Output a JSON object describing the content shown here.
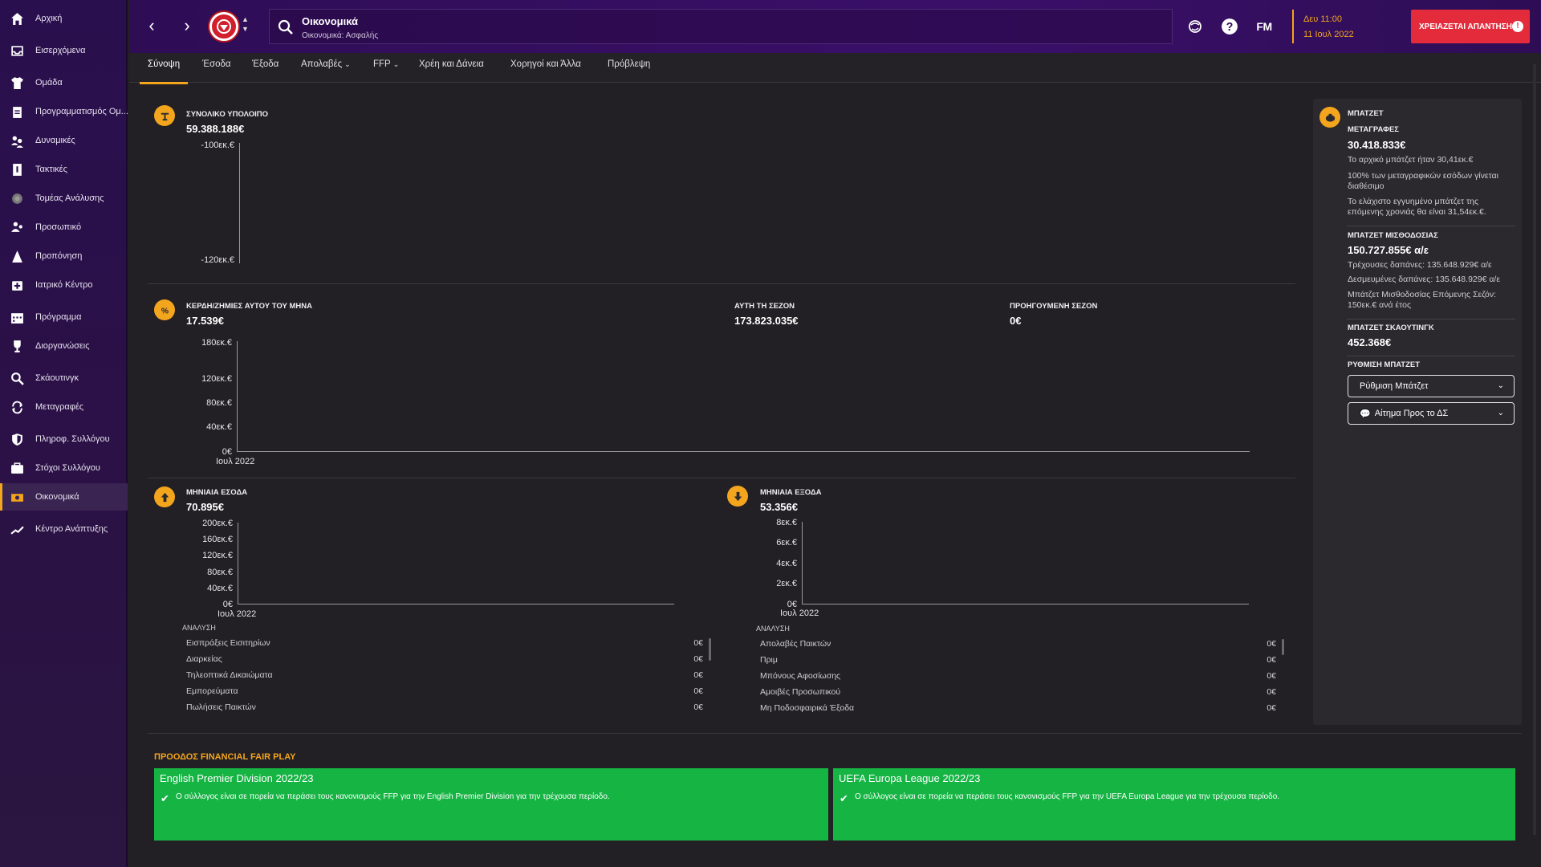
{
  "sidebar": {
    "items": [
      {
        "label": "Αρχική",
        "icon": "home-icon"
      },
      {
        "label": "Εισερχόμενα",
        "icon": "inbox-icon"
      },
      {
        "label": "Ομάδα",
        "icon": "shirt-icon"
      },
      {
        "label": "Προγραμματισμός Ομ...",
        "icon": "clipboard-icon"
      },
      {
        "label": "Δυναμικές",
        "icon": "people-dynamics-icon"
      },
      {
        "label": "Τακτικές",
        "icon": "tactics-board-icon"
      },
      {
        "label": "Τομέας Ανάλυσης",
        "icon": "analysis-icon"
      },
      {
        "label": "Προσωπικό",
        "icon": "staff-icon"
      },
      {
        "label": "Προπόνηση",
        "icon": "training-cone-icon"
      },
      {
        "label": "Ιατρικό Κέντρο",
        "icon": "medical-icon"
      },
      {
        "label": "Πρόγραμμα",
        "icon": "calendar-icon"
      },
      {
        "label": "Διοργανώσεις",
        "icon": "trophy-icon"
      },
      {
        "label": "Σκάουτινγκ",
        "icon": "scouting-icon"
      },
      {
        "label": "Μεταγραφές",
        "icon": "transfers-icon"
      },
      {
        "label": "Πληροφ. Συλλόγου",
        "icon": "club-shield-icon"
      },
      {
        "label": "Στόχοι Συλλόγου",
        "icon": "vision-icon"
      },
      {
        "label": "Οικονομικά",
        "icon": "finances-icon"
      },
      {
        "label": "Κέντρο Ανάπτυξης",
        "icon": "development-icon"
      }
    ],
    "active": "Οικονομικά"
  },
  "topbar": {
    "search_title": "Οικονομικά",
    "search_sub": "Οικονομικά: Ασφαλής",
    "fm_logo": "FM",
    "date_line1": "Δευ 11:00",
    "date_line2": "11 Ιουλ 2022",
    "reply_button": "ΧΡΕΙΑΖΕΤΑΙ ΑΠΑΝΤΗΣΗ",
    "reply_badge": "!"
  },
  "tabs": [
    {
      "label": "Σύνοψη",
      "dropdown": false
    },
    {
      "label": "Έσοδα",
      "dropdown": false
    },
    {
      "label": "Έξοδα",
      "dropdown": false
    },
    {
      "label": "Απολαβές",
      "dropdown": true
    },
    {
      "label": "FFP",
      "dropdown": true
    },
    {
      "label": "Χρέη και Δάνεια",
      "dropdown": false
    },
    {
      "label": "Χορηγοί και Άλλα",
      "dropdown": false
    },
    {
      "label": "Πρόβλεψη",
      "dropdown": false
    }
  ],
  "balance": {
    "label": "ΣΥΝΟΛΙΚΟ ΥΠΟΛΟΙΠΟ",
    "value": "59.388.188€",
    "y_ticks": [
      "-100εκ.€",
      "-120εκ.€"
    ]
  },
  "monthly_profit": {
    "label": "ΚΕΡΔΗ/ΖΗΜΙΕΣ ΑΥΤΟΥ ΤΟΥ ΜΗΝΑ",
    "value": "17.539€",
    "season_label": "ΑΥΤΗ ΤΗ ΣΕΖΟΝ",
    "season_value": "173.823.035€",
    "prev_label": "ΠΡΟΗΓΟΥΜΕΝΗ ΣΕΖΟΝ",
    "prev_value": "0€",
    "y_ticks": [
      "180εκ.€",
      "120εκ.€",
      "80εκ.€",
      "40εκ.€",
      "0€"
    ],
    "x_label": "Ιουλ 2022"
  },
  "monthly_income": {
    "label": "ΜΗΝΙΑΙΑ ΕΣΟΔΑ",
    "value": "70.895€",
    "y_ticks": [
      "200εκ.€",
      "160εκ.€",
      "120εκ.€",
      "80εκ.€",
      "40εκ.€",
      "0€"
    ],
    "x_label": "Ιουλ 2022",
    "breakdown_label": "ΑΝΑΛΥΣΗ",
    "breakdown": [
      {
        "name": "Εισπράξεις Εισιτηρίων",
        "value": "0€"
      },
      {
        "name": "Διαρκείας",
        "value": "0€"
      },
      {
        "name": "Τηλεοπτικά Δικαιώματα",
        "value": "0€"
      },
      {
        "name": "Εμπορεύματα",
        "value": "0€"
      },
      {
        "name": "Πωλήσεις Παικτών",
        "value": "0€"
      }
    ]
  },
  "monthly_expenses": {
    "label": "ΜΗΝΙΑΙΑ ΕΞΟΔΑ",
    "value": "53.356€",
    "y_ticks": [
      "8εκ.€",
      "6εκ.€",
      "4εκ.€",
      "2εκ.€",
      "0€"
    ],
    "x_label": "Ιουλ 2022",
    "breakdown_label": "ΑΝΑΛΥΣΗ",
    "breakdown": [
      {
        "name": "Απολαβές Παικτών",
        "value": "0€"
      },
      {
        "name": "Πριμ",
        "value": "0€"
      },
      {
        "name": "Μπόνους Αφοσίωσης",
        "value": "0€"
      },
      {
        "name": "Αμοιβές Προσωπικού",
        "value": "0€"
      },
      {
        "name": "Μη Ποδοσφαιρικά Έξοδα",
        "value": "0€"
      }
    ]
  },
  "budget": {
    "title": "ΜΠΑΤΖΕΤ",
    "transfers_label": "ΜΕΤΑΓΡΑΦΕΣ",
    "transfers_value": "30.418.833€",
    "transfers_note1": "Το αρχικό μπάτζετ ήταν 30,41εκ.€",
    "transfers_note2a": "100% των μεταγραφικών εσόδων γίνεται",
    "transfers_note2b": "διαθέσιμο",
    "transfers_note3a": "Το ελάχιστο εγγυημένο μπάτζετ της",
    "transfers_note3b": "επόμενης χρονιάς θα είναι 31,54εκ.€.",
    "wage_label": "ΜΠΑΤΖΕΤ ΜΙΣΘΟΔΟΣΙΑΣ",
    "wage_value": "150.727.855€ α/ε",
    "wage_current": "Τρέχουσες δαπάνες: 135.648.929€ α/ε",
    "wage_committed": "Δεσμευμένες δαπάνες: 135.648.929€ α/ε",
    "wage_next_a": "Μπάτζετ Μισθοδοσίας Επόμενης Σεζόν:",
    "wage_next_b": "150εκ.€ ανά έτος",
    "scouting_label": "ΜΠΑΤΖΕΤ ΣΚΑΟΥΤΙΝΓΚ",
    "scouting_value": "452.368€",
    "settings_label": "ΡΥΘΜΙΣΗ ΜΠΑΤΖΕΤ",
    "settings_button": "Ρύθμιση Μπάτζετ",
    "board_button": "Αίτημα Προς το ΔΣ"
  },
  "ffp": {
    "title": "ΠΡΟΟΔΟΣ FINANCIAL FAIR PLAY",
    "cards": [
      {
        "title": "English Premier Division 2022/23",
        "text": "Ο σύλλογος είναι σε πορεία να περάσει τους κανονισμούς FFP για την English Premier Division για την τρέχουσα περίοδο."
      },
      {
        "title": "UEFA Europa League 2022/23",
        "text": "Ο σύλλογος είναι σε πορεία να περάσει τους κανονισμούς FFP για την UEFA Europa League για την τρέχουσα περίοδο."
      }
    ],
    "card_color": "#15b443"
  },
  "colors": {
    "accent": "#f3a51d",
    "alert": "#e42b3b",
    "sidebar": "#2a0f4e"
  }
}
